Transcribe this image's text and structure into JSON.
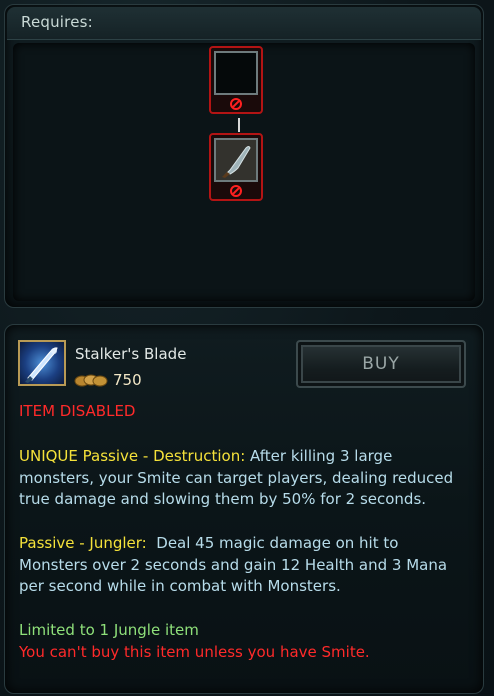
{
  "requires": {
    "title": "Requires:"
  },
  "item": {
    "name": "Stalker's Blade",
    "price": "750",
    "buy_label": "BUY",
    "status": "ITEM DISABLED",
    "unique_label": "UNIQUE Passive - Destruction:",
    "unique_text": " After killing 3 large monsters, your Smite can target players, dealing reduced true damage and slowing them by 50% for 2 seconds.",
    "passive_label": "Passive - Jungler:",
    "passive_text": "  Deal 45 magic damage on hit to Monsters over 2 seconds and gain 12 Health and 3 Mana per second while in combat with Monsters.",
    "limit_text": "Limited to 1 Jungle item",
    "restriction_text": "You can't buy this item unless you have Smite."
  },
  "colors": {
    "disabled_red": "#ff2a2a",
    "unique_yellow": "#f5e23a",
    "desc_blue": "#b7dcea",
    "limit_green": "#8fe07a"
  }
}
